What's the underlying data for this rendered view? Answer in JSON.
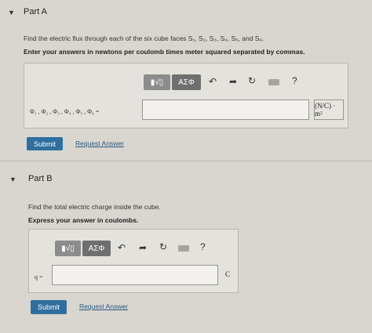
{
  "part_a": {
    "caret": "▼",
    "title": "Part A",
    "prompt": "Find the electric flux through each of the six cube faces S₁, S₂, S₃, S₄, S₅, and S₆.",
    "instruction": "Enter your answers in newtons per coulomb times meter squared separated by commas.",
    "toolbar": {
      "templates_label": "▮√▯",
      "symbols_label": "ΑΣΦ",
      "undo": "↶",
      "redo": "➦",
      "reset": "↻",
      "help": "?"
    },
    "variable_label": "Φ₁ , Φ₂ , Φ₃ , Φ₄ , Φ₅ , Φ₆ =",
    "input_value": "",
    "units": "(N/C) · m²",
    "submit_label": "Submit",
    "request_answer_label": "Request Answer"
  },
  "part_b": {
    "caret": "▼",
    "title": "Part B",
    "prompt": "Find the total electric charge inside the cube.",
    "instruction": "Express your answer in coulombs.",
    "toolbar": {
      "templates_label": "▮√▯",
      "symbols_label": "ΑΣΦ",
      "undo": "↶",
      "redo": "➦",
      "reset": "↻",
      "help": "?"
    },
    "variable_label": "q =",
    "input_value": "",
    "units": "C",
    "submit_label": "Submit",
    "request_answer_label": "Request Answer"
  }
}
